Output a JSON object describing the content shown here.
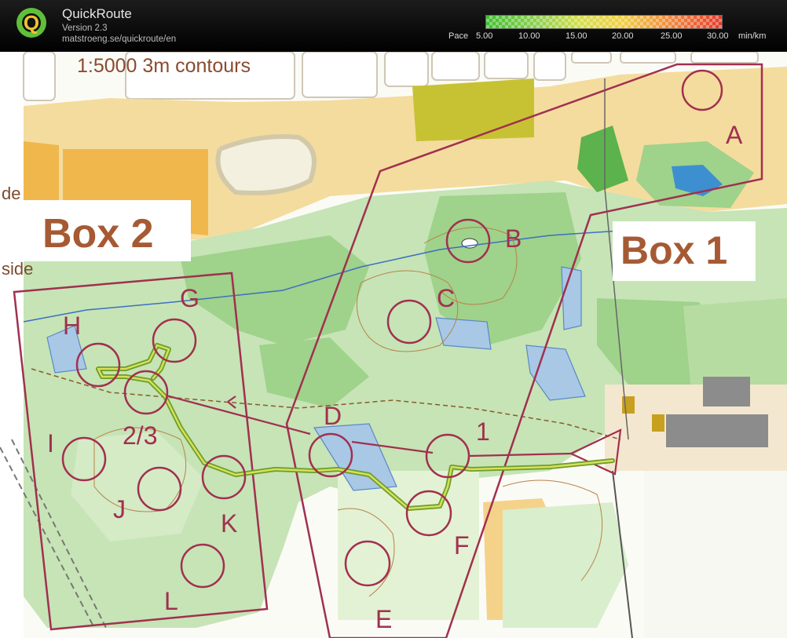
{
  "app": {
    "title": "QuickRoute",
    "version": "Version 2.3",
    "url": "matstroeng.se/quickroute/en"
  },
  "pace_scale": {
    "label": "Pace",
    "ticks": [
      "5.00",
      "10.00",
      "15.00",
      "20.00",
      "25.00",
      "30.00"
    ],
    "unit": "min/km"
  },
  "map": {
    "scale_label": "1:5000 3m contours",
    "box1_label": "Box 1",
    "box2_label": "Box 2",
    "edge_text_1": "de",
    "edge_text_2": "side",
    "controls": [
      "A",
      "B",
      "C",
      "D",
      "E",
      "F",
      "G",
      "H",
      "I",
      "J",
      "K",
      "L",
      "1",
      "2/3"
    ]
  },
  "colors": {
    "course_purple": "#a1304f",
    "route_green": "#6a9e2c",
    "route_yellow": "#d9df58",
    "forest_light": "#c6e4b6",
    "forest_medium": "#9fd28b",
    "open_yellow": "#f3d999",
    "rough_open": "#f0b74c",
    "water_blue": "#3d8fd0",
    "paper": "#fbfbf6"
  }
}
